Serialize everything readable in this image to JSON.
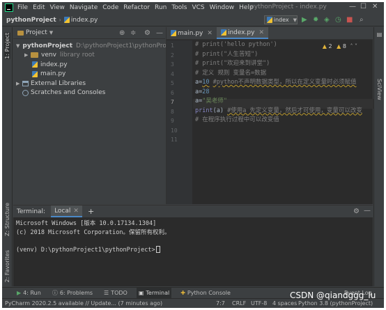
{
  "menu": {
    "items": [
      "File",
      "Edit",
      "View",
      "Navigate",
      "Code",
      "Refactor",
      "Run",
      "Tools",
      "VCS",
      "Window",
      "Help"
    ],
    "window_title": "pythonProject - index.py"
  },
  "navbar": {
    "project": "pythonProject",
    "file": "index.py",
    "run_config": "index"
  },
  "left_stripe": {
    "project_tab": "1: Project",
    "structure_tab": "Z: Structure",
    "favorites_tab": "2: Favorites"
  },
  "project_panel": {
    "title": "Project",
    "tree": {
      "root_name": "pythonProject",
      "root_path": "D:\\pythonProject1\\pythonProject",
      "venv_name": "venv",
      "venv_note": "library root",
      "file1": "index.py",
      "file2": "main.py",
      "external_libs": "External Libraries",
      "scratches": "Scratches and Consoles"
    }
  },
  "editor": {
    "tabs": [
      "main.py",
      "index.py"
    ],
    "active_tab": 1,
    "inspections": {
      "warnings": "2",
      "weak_warnings": "8"
    },
    "line_numbers": [
      "1",
      "2",
      "3",
      "4",
      "5",
      "6",
      "7",
      "8",
      "9",
      "10",
      "11"
    ],
    "code": {
      "l1": "# print('hello python')",
      "l2": "# print(\"人生苦短\")",
      "l3": "# print(\"欢迎来到讲堂\")",
      "l4": "# 定义 规则 变量名=数据",
      "l5_var": "a",
      "l5_eq": "=",
      "l5_num": "10",
      "l5_comment": "#python不声明数据类型，所以在定义变量时必须赋值",
      "l6_var": "a",
      "l6_eq": "=",
      "l6_num": "28",
      "l7_var": "a",
      "l7_eq": "=",
      "l7_str": "\"吴老师\"",
      "l8_func": "print",
      "l8_args": "(a)",
      "l8_comment": "#使用a 先定义变量，然后才可使用，变量可以改变",
      "l9": "# 在程序执行过程中可以改变值"
    }
  },
  "right_stripe": {
    "sciview_tab": "SciView"
  },
  "terminal": {
    "title": "Terminal:",
    "tab": "Local",
    "lines": [
      "Microsoft Windows [版本 10.0.17134.1304]",
      "(c) 2018 Microsoft Corporation。保留所有权利。",
      "",
      "(venv) D:\\pythonProject1\\pythonProject>"
    ]
  },
  "tool_windows": {
    "run": "4: Run",
    "problems": "6: Problems",
    "todo": "TODO",
    "terminal": "Terminal",
    "python_console": "Python Console",
    "event_log": "Event Log"
  },
  "statusbar": {
    "message": "PyCharm 2020.2.5 available // Update... (7 minutes ago)",
    "position": "7:7",
    "line_sep": "CRLF",
    "encoding": "UTF-8",
    "indent": "4 spaces",
    "interpreter": "Python 3.8 (pythonProject)"
  },
  "watermark": "CSDN @qiandggg_lu",
  "colors": {
    "background": "#3c3f41",
    "editor_bg": "#2b2b2b",
    "comment": "#808080",
    "number": "#6897bb",
    "string": "#6a8759",
    "builtin": "#8888c6",
    "accent": "#4a88c7"
  }
}
